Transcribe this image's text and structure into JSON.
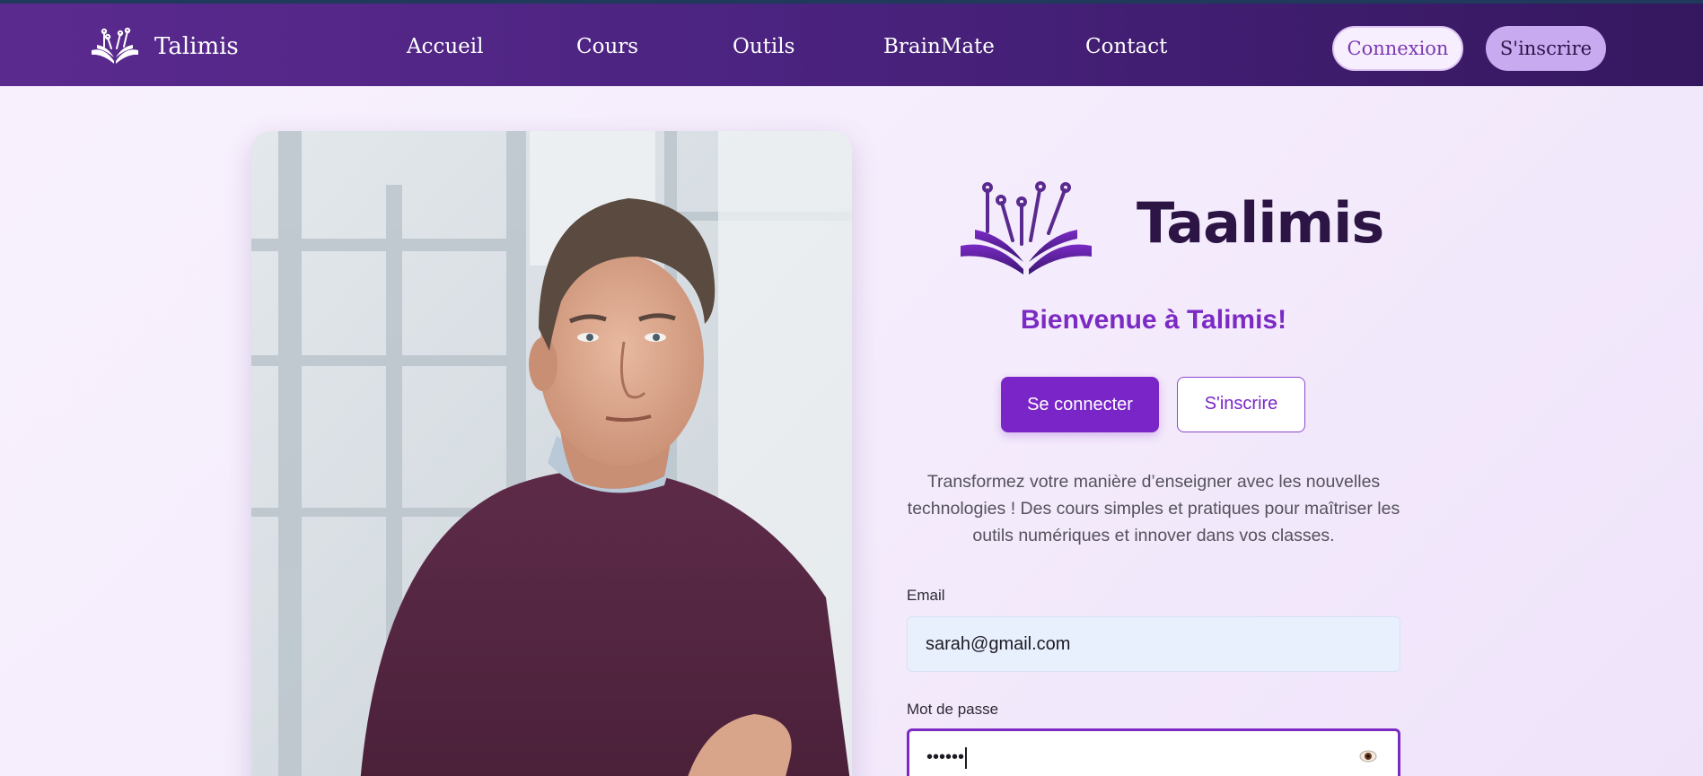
{
  "header": {
    "brand": "Talimis",
    "nav": [
      "Accueil",
      "Cours",
      "Outils",
      "BrainMate",
      "Contact"
    ],
    "login_label": "Connexion",
    "register_label": "S'inscrire"
  },
  "hero": {
    "logo_text": "Taalimis",
    "welcome": "Bienvenue à Talimis!",
    "signin_button": "Se connecter",
    "signup_button": "S'inscrire",
    "description": "Transformez votre manière d’enseigner avec les nouvelles technologies ! Des cours simples et pratiques pour maîtriser les outils numériques et innover dans vos classes."
  },
  "form": {
    "email_label": "Email",
    "email_value": "sarah@gmail.com",
    "password_label": "Mot de passe",
    "password_value": "••••••"
  },
  "icons": {
    "brand": "book-circuit-logo-icon",
    "password_toggle": "eye-icon"
  },
  "colors": {
    "nav_bg": "#4b2380",
    "accent": "#7a25c8",
    "logo_text": "#2c1445",
    "email_fill": "#e8f0fe"
  }
}
